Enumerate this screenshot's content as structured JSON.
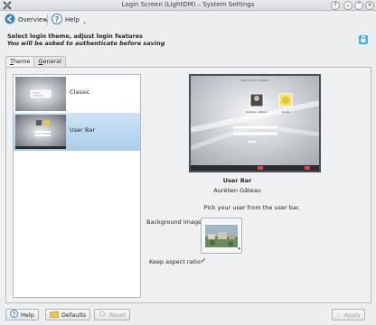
{
  "window": {
    "title": "Login Screen (LightDM) – System Settings"
  },
  "toolbar": {
    "overview_label": "Overview",
    "help_label": "Help"
  },
  "header": {
    "line1": "Select login theme, adjust login features",
    "line2": "You will be asked to authenticate before saving"
  },
  "tabs": [
    {
      "label": "Theme",
      "accel": "T",
      "rest": "heme"
    },
    {
      "label": "General",
      "accel": "G",
      "rest": "eneral"
    }
  ],
  "themes": [
    {
      "name": "Classic"
    },
    {
      "name": "User Bar"
    }
  ],
  "preview": {
    "welcome_text": "Welcome to kubuntu",
    "user1": "Aurélien Gâteau",
    "user2": "Guest"
  },
  "theme_details": {
    "title": "User Bar",
    "author": "Aurélien Gâteau",
    "description": "Pick your user from the user bar."
  },
  "options": {
    "background_label": "Background image:",
    "aspect_label": "Keep aspect ratio:",
    "aspect_checked": "✓"
  },
  "buttons": {
    "help": "Help",
    "defaults": "Defaults",
    "reset": "Reset",
    "apply": "Apply"
  },
  "colors": {
    "selection": "#a9cde9",
    "accent": "#3daee9"
  }
}
